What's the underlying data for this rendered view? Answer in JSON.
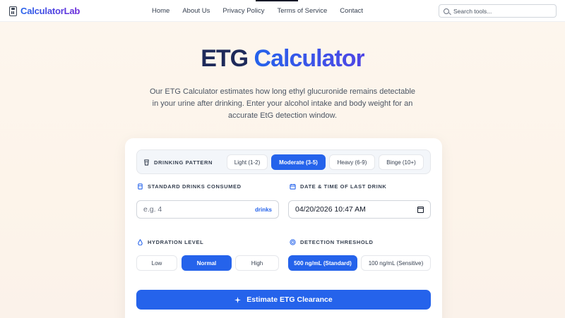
{
  "header": {
    "logo": "CalculatorLab",
    "nav": [
      "Home",
      "About Us",
      "Privacy Policy",
      "Terms of Service",
      "Contact"
    ],
    "search_placeholder": "Search tools..."
  },
  "hero": {
    "title_part1": "ETG",
    "title_part2": "Calculator",
    "description": "Our ETG Calculator estimates how long ethyl glucuronide remains detectable in your urine after drinking. Enter your alcohol intake and body weight for an accurate EtG detection window."
  },
  "form": {
    "drinking_pattern": {
      "label": "DRINKING PATTERN",
      "options": [
        "Light (1-2)",
        "Moderate (3-5)",
        "Heavy (6-9)",
        "Binge (10+)"
      ],
      "selected": "Moderate (3-5)"
    },
    "drinks": {
      "label": "STANDARD DRINKS CONSUMED",
      "placeholder": "e.g. 4",
      "unit": "drinks"
    },
    "last_drink": {
      "label": "DATE & TIME OF LAST DRINK",
      "value": "04/20/2026 10:47 AM"
    },
    "hydration": {
      "label": "HYDRATION LEVEL",
      "options": [
        "Low",
        "Normal",
        "High"
      ],
      "selected": "Normal"
    },
    "threshold": {
      "label": "DETECTION THRESHOLD",
      "options": [
        "500 ng/mL (Standard)",
        "100 ng/mL (Sensitive)"
      ],
      "selected": "500 ng/mL (Standard)"
    },
    "submit_label": "Estimate ETG Clearance"
  },
  "colors": {
    "accent": "#2563eb",
    "title_dark": "#1e2a5a"
  }
}
